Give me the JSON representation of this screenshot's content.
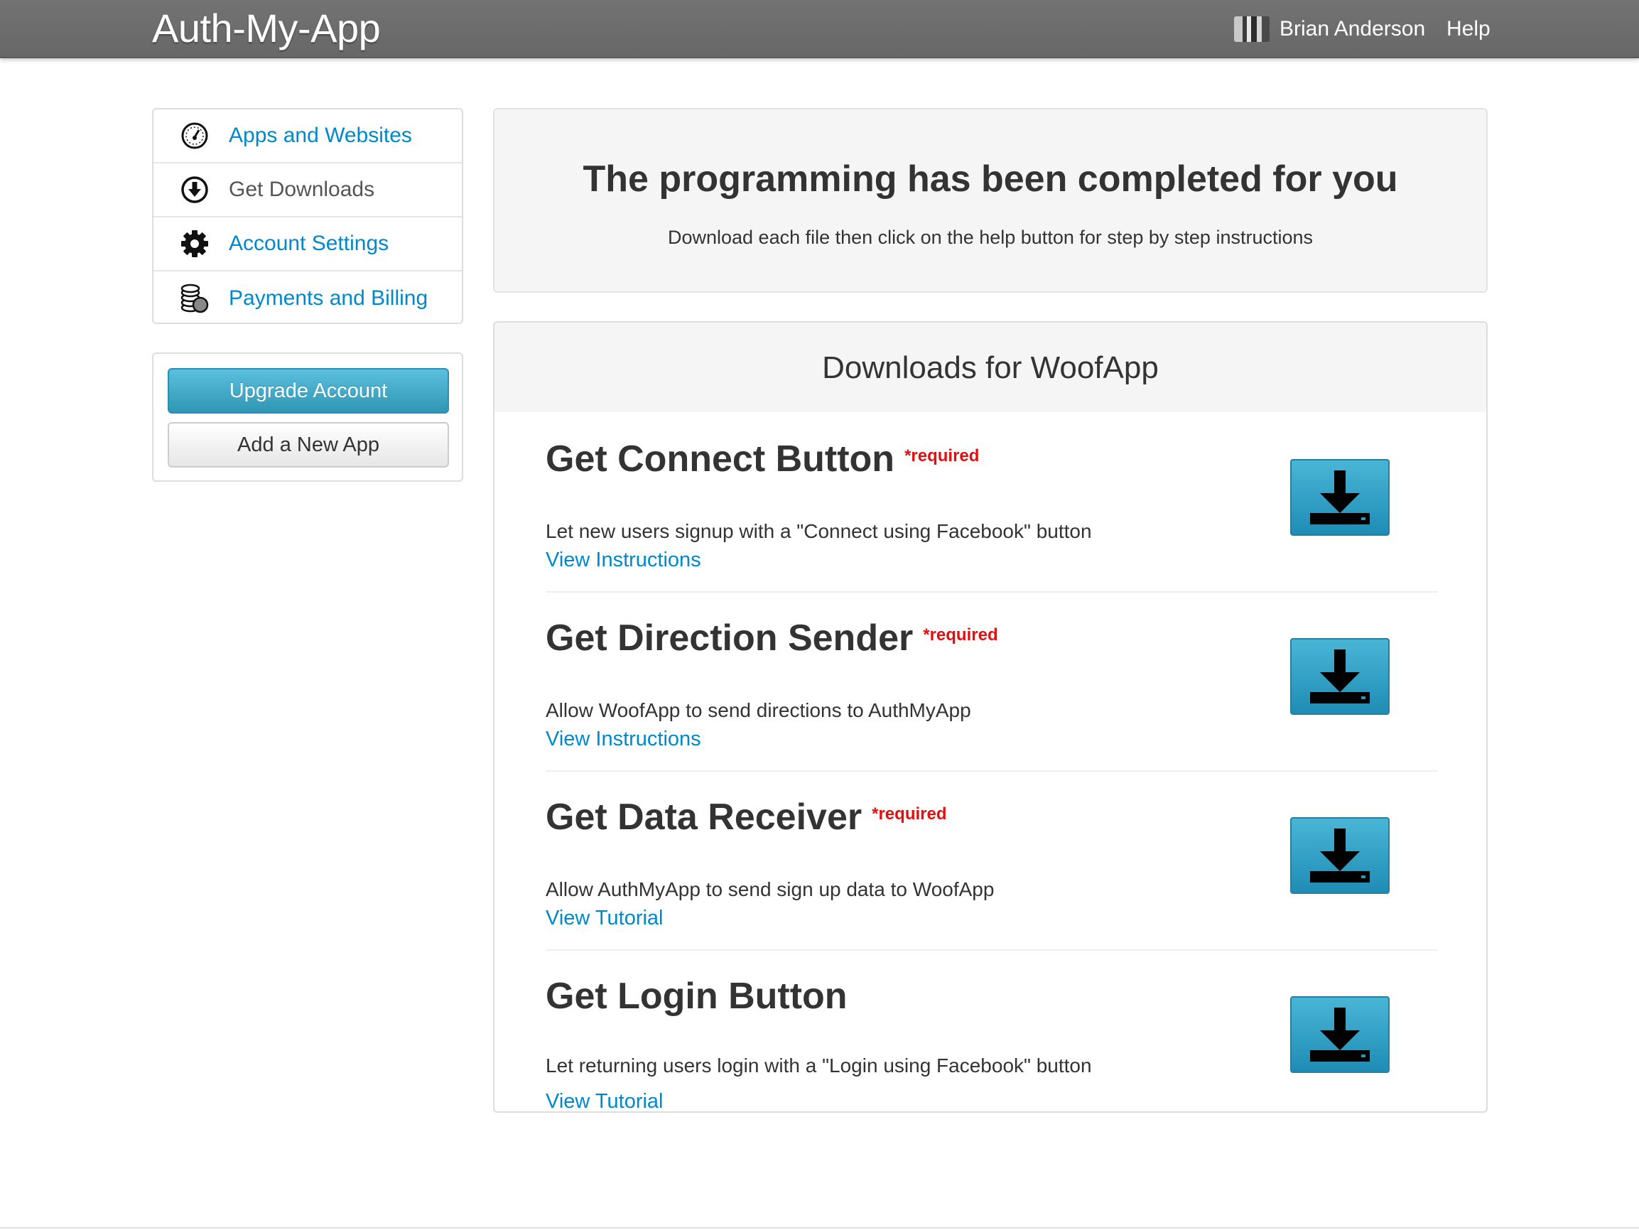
{
  "navbar": {
    "brand": "Auth-My-App",
    "user_name": "Brian Anderson",
    "help": "Help"
  },
  "sidebar": {
    "items": [
      {
        "label": "Apps and Websites",
        "icon": "dashboard-gauge-icon",
        "active": false
      },
      {
        "label": "Get Downloads",
        "icon": "download-circle-icon",
        "active": true
      },
      {
        "label": "Account Settings",
        "icon": "gear-icon",
        "active": false
      },
      {
        "label": "Payments and Billing",
        "icon": "coins-icon",
        "active": false
      }
    ],
    "upgrade_button": "Upgrade Account",
    "add_app_button": "Add a New App"
  },
  "hero": {
    "title": "The programming has been completed for you",
    "subtitle": "Download each file then click on the help button for step by step instructions"
  },
  "downloads": {
    "title": "Downloads for WoofApp",
    "items": [
      {
        "title": "Get Connect Button",
        "required": "*required",
        "description": "Let new users signup with a \"Connect using Facebook\" button",
        "link": "View Instructions"
      },
      {
        "title": "Get Direction Sender",
        "required": "*required",
        "description": "Allow WoofApp to send directions to AuthMyApp",
        "link": "View Instructions"
      },
      {
        "title": "Get Data Receiver",
        "required": "*required",
        "description": "Allow AuthMyApp to send sign up data to WoofApp",
        "link": "View Tutorial"
      },
      {
        "title": "Get Login Button",
        "required": "",
        "description": "Let returning users login with a \"Login using Facebook\" button",
        "link": "View Tutorial"
      }
    ]
  },
  "colors": {
    "navbar": "#6e6e6e",
    "link": "#0088cc",
    "required": "#e01010",
    "primary_button": "#2f96b4",
    "download_button": "#1f8cb5"
  }
}
